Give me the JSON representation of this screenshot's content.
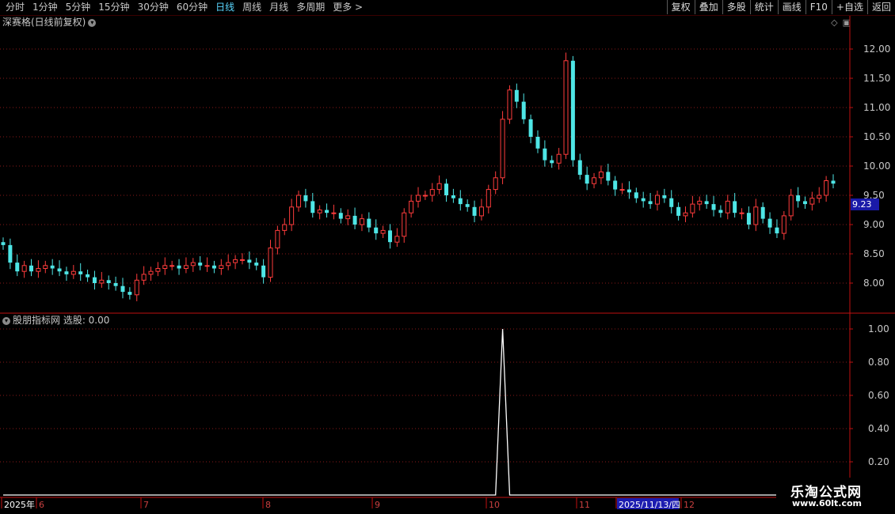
{
  "toolbar": {
    "periods": [
      "分时",
      "1分钟",
      "5分钟",
      "15分钟",
      "30分钟",
      "60分钟",
      "日线",
      "周线",
      "月线",
      "多周期",
      "更多 >"
    ],
    "active_period": "日线",
    "buttons": [
      "复权",
      "叠加",
      "多股",
      "统计",
      "画线",
      "F10",
      "+自选",
      "返回"
    ]
  },
  "main_pane": {
    "title": "深赛格(日线前复权)",
    "price_tag": "9.23",
    "axis_labels": [
      "12.00",
      "11.50",
      "11.00",
      "10.50",
      "10.00",
      "9.50",
      "9.00",
      "8.50",
      "8.00"
    ]
  },
  "indicator_pane": {
    "title": "股朋指标网 选股: 0.00",
    "axis_labels": [
      "1.00",
      "0.80",
      "0.60",
      "0.40",
      "0.20"
    ]
  },
  "date_axis": {
    "labels": [
      "2025年",
      "6",
      "7",
      "8",
      "9",
      "10",
      "11",
      "2025/11/13/四",
      "12"
    ]
  },
  "watermark": {
    "title": "乐淘公式网",
    "url": "www.60lt.com"
  },
  "colors": {
    "up": "#ff3c3c",
    "down": "#4ee6e6",
    "grid": "#8a1a1a",
    "axis": "#c01010",
    "selected_date_bg": "#1c1cb0"
  },
  "chart_data": [
    {
      "type": "candlestick",
      "title": "深赛格(日线前复权)",
      "ylim": [
        7.6,
        12.4
      ],
      "y_ticks": [
        12.0,
        11.5,
        11.0,
        10.5,
        10.0,
        9.5,
        9.0,
        8.5,
        8.0
      ],
      "x_labels": [
        "2025年",
        "6",
        "7",
        "8",
        "9",
        "10",
        "11",
        "2025/11/13/四",
        "12"
      ],
      "approx_close": [
        8.65,
        8.35,
        8.2,
        8.3,
        8.2,
        8.25,
        8.3,
        8.25,
        8.2,
        8.15,
        8.2,
        8.15,
        8.1,
        8.0,
        8.05,
        8.0,
        7.95,
        7.85,
        7.8,
        8.05,
        8.15,
        8.2,
        8.25,
        8.3,
        8.3,
        8.25,
        8.3,
        8.35,
        8.3,
        8.3,
        8.25,
        8.3,
        8.35,
        8.4,
        8.4,
        8.35,
        8.3,
        8.1,
        8.6,
        8.9,
        9.0,
        9.3,
        9.5,
        9.4,
        9.2,
        9.25,
        9.2,
        9.2,
        9.1,
        9.15,
        9.0,
        9.1,
        8.95,
        8.85,
        8.9,
        8.7,
        8.8,
        9.2,
        9.4,
        9.5,
        9.5,
        9.6,
        9.7,
        9.5,
        9.45,
        9.35,
        9.3,
        9.15,
        9.3,
        9.6,
        9.8,
        10.8,
        11.3,
        11.1,
        10.8,
        10.5,
        10.3,
        10.1,
        10.05,
        10.2,
        11.8,
        10.1,
        9.85,
        9.7,
        9.8,
        9.9,
        9.75,
        9.6,
        9.6,
        9.55,
        9.45,
        9.4,
        9.35,
        9.5,
        9.45,
        9.3,
        9.15,
        9.2,
        9.35,
        9.4,
        9.35,
        9.25,
        9.2,
        9.4,
        9.2,
        9.2,
        9.0,
        9.3,
        9.1,
        8.95,
        8.85,
        9.15,
        9.5,
        9.4,
        9.35,
        9.45,
        9.5,
        9.75,
        9.7
      ],
      "last_price": 9.23
    },
    {
      "type": "line",
      "title": "股朋指标网 选股: 0.00",
      "ylim": [
        0,
        1.0
      ],
      "y_ticks": [
        1.0,
        0.8,
        0.6,
        0.4,
        0.2
      ],
      "series": [
        {
          "values_note": "",
          "spike_value": 1.0
        }
      ],
      "values": [
        0,
        0,
        0,
        0,
        0,
        0,
        0,
        0,
        0,
        0,
        0,
        0,
        0,
        0,
        0,
        0,
        0,
        0,
        0,
        0,
        0,
        0,
        0,
        0,
        0,
        0,
        0,
        0,
        0,
        0,
        0,
        0,
        0,
        0,
        0,
        0,
        0,
        0,
        0,
        0,
        0,
        0,
        0,
        0,
        0,
        0,
        0,
        0,
        0,
        0,
        0,
        0,
        0,
        0,
        0,
        0,
        0,
        0,
        0,
        0,
        0,
        0,
        0,
        0,
        0,
        0,
        0,
        0,
        0,
        0,
        0,
        1,
        0,
        0,
        0,
        0,
        0,
        0,
        0,
        0,
        0,
        0,
        0,
        0,
        0,
        0,
        0,
        0,
        0,
        0,
        0,
        0,
        0,
        0,
        0,
        0,
        0,
        0,
        0,
        0,
        0,
        0,
        0,
        0,
        0,
        0,
        0,
        0,
        0,
        0,
        0,
        0,
        0,
        0,
        0,
        0,
        0,
        0,
        0,
        0
      ]
    }
  ]
}
